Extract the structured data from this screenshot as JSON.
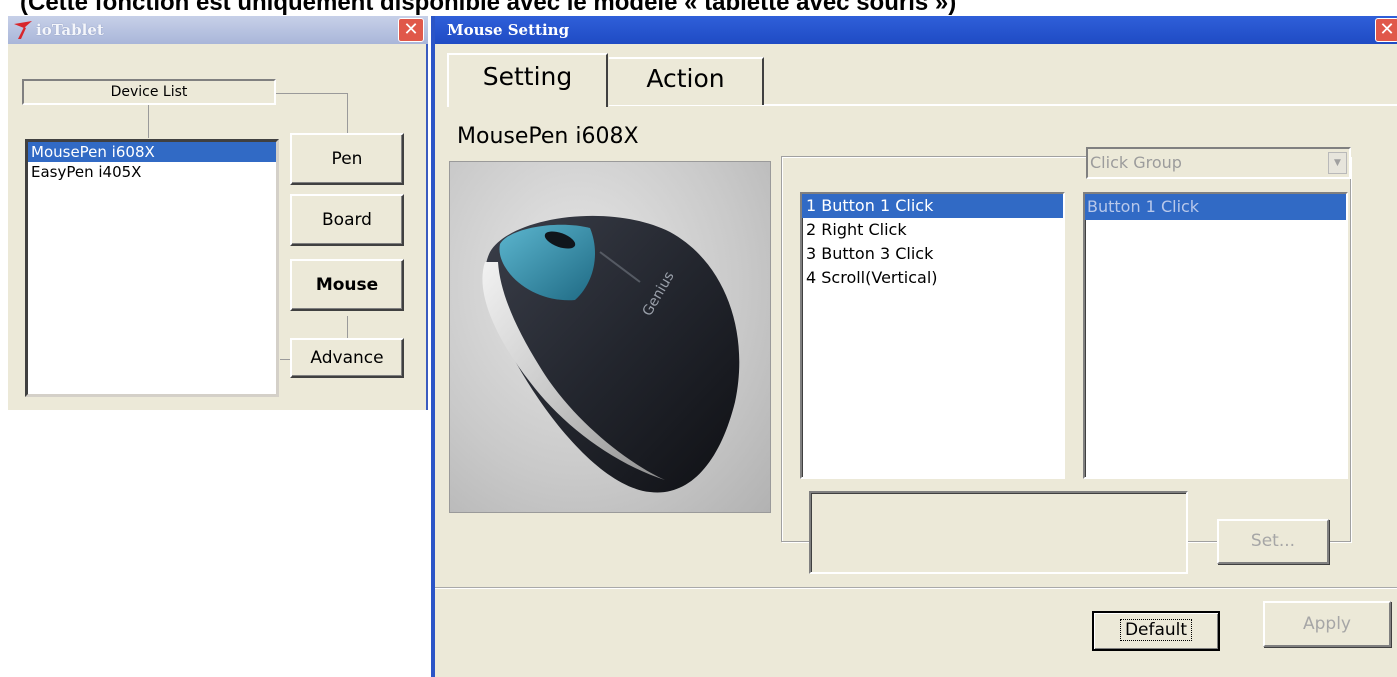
{
  "caption": "(Cette fonction est uniquement disponible avec le modèle « tablette avec souris »)",
  "left_window": {
    "title": "ioTablet",
    "close_label": "✕",
    "device_header": "Device List",
    "devices": [
      "MousePen i608X",
      "EasyPen i405X"
    ],
    "selected_device": "MousePen i608X",
    "nav_buttons": [
      "Pen",
      "Board",
      "Mouse",
      "Advance"
    ],
    "active_nav": "Mouse"
  },
  "right_window": {
    "title": "Mouse Setting",
    "close_label": "✕",
    "tabs": [
      "Setting",
      "Action"
    ],
    "active_tab": "Setting",
    "device_name": "MousePen i608X",
    "photo_brand": "Genius",
    "actions": [
      "1 Button 1 Click",
      "2 Right Click",
      "3 Button 3 Click",
      "4 Scroll(Vertical)"
    ],
    "selected_action": "1 Button 1 Click",
    "click_group": {
      "placeholder": "Click Group",
      "selected": "Button 1 Click"
    },
    "set_label": "Set...",
    "default_label": "Default",
    "apply_label": "Apply"
  },
  "colors": {
    "selection": "#316ac5",
    "window_face": "#ece9d8",
    "title_active": "#2f5fd9",
    "title_inactive": "#a9b6d9",
    "close_red": "#e0584a"
  }
}
